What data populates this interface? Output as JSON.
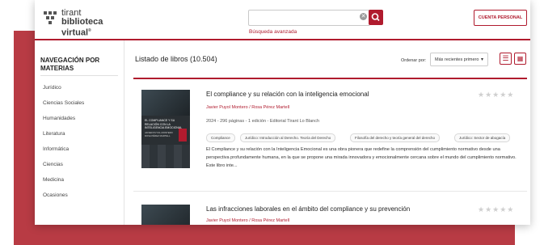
{
  "header": {
    "logo_line1": "tirant",
    "logo_line2": "biblioteca virtual",
    "logo_mark": "®",
    "search_placeholder": "",
    "advanced_search": "Búsqueda avanzada",
    "account_button": "CUENTA PERSONAL"
  },
  "sidebar": {
    "title": "NAVEGACIÓN POR MATERIAS",
    "items": [
      "Jurídico",
      "Ciencias Sociales",
      "Humanidades",
      "Literatura",
      "Informática",
      "Ciencias",
      "Medicina",
      "Ocasiones"
    ]
  },
  "main": {
    "title": "Listado de libros (10.504)",
    "order_label": "Ordenar por:",
    "order_value": "Más recientes primero"
  },
  "books": [
    {
      "title": "El compliance y su relación con la inteligencia emocional",
      "authors": "Javier Puyol Montero / Rosa Pérez Martell",
      "meta": "2024 - 296 páginas - 1 edición - Editorial Tirant Lo Blanch",
      "tags": [
        "Compliance",
        "Jurídico: Introducción al Derecho. Teoría del Derecho",
        "Filosofía del derecho y teoría general del derecho",
        "Jurídico: Sector de abogacía"
      ],
      "description": "El Compliance y su relación con la Inteligencia Emocional es una obra pionera que redefine la comprensión del cumplimiento normativo desde una perspectiva profundamente humana, en la que se propone una mirada innovadora y emocionalmente cercana sobre el mundo del cumplimiento normativo. Este libro inte...",
      "cover_title": "EL COMPLIANCE Y SU RELACIÓN CON LA INTELIGENCIA EMOCIONAL",
      "cover_authors": "JAVIER PUYOL MONTERO ROSA PÉREZ MARTELL",
      "stars": "★★★★★",
      "rating_stars": 0
    },
    {
      "title": "Las infracciones laborales en el ámbito del compliance y su prevención",
      "authors": "Javier Puyol Montero / Rosa Pérez Martell",
      "stars": "★★★★★",
      "rating_stars": 0
    }
  ],
  "colors": {
    "accent": "#b01b2e",
    "backdrop": "#b83b44",
    "cover": "#2a2f33"
  },
  "icons": [
    "logo-mark-icon",
    "clear-icon",
    "search-icon",
    "caret-down-icon",
    "list-view-icon",
    "grid-view-icon",
    "star-icon"
  ]
}
